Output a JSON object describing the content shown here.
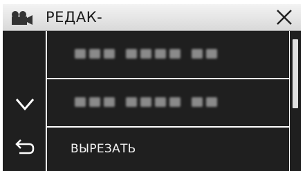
{
  "header": {
    "title": "РЕДАК-",
    "mode_icon": "video-camera-icon",
    "close_icon": "close-icon"
  },
  "sidebar": {
    "down_icon": "chevron-down-icon",
    "back_icon": "return-arrow-icon"
  },
  "menu": {
    "items": [
      {
        "label": ""
      },
      {
        "label": ""
      },
      {
        "label": "ВЫРЕЗАТЬ"
      }
    ]
  },
  "colors": {
    "panel": "#1f1f1f",
    "header_top": "#f3f3f3",
    "header_bottom": "#d9d9d9",
    "text_light": "#f2f2f2",
    "divider": "#ffffff"
  }
}
